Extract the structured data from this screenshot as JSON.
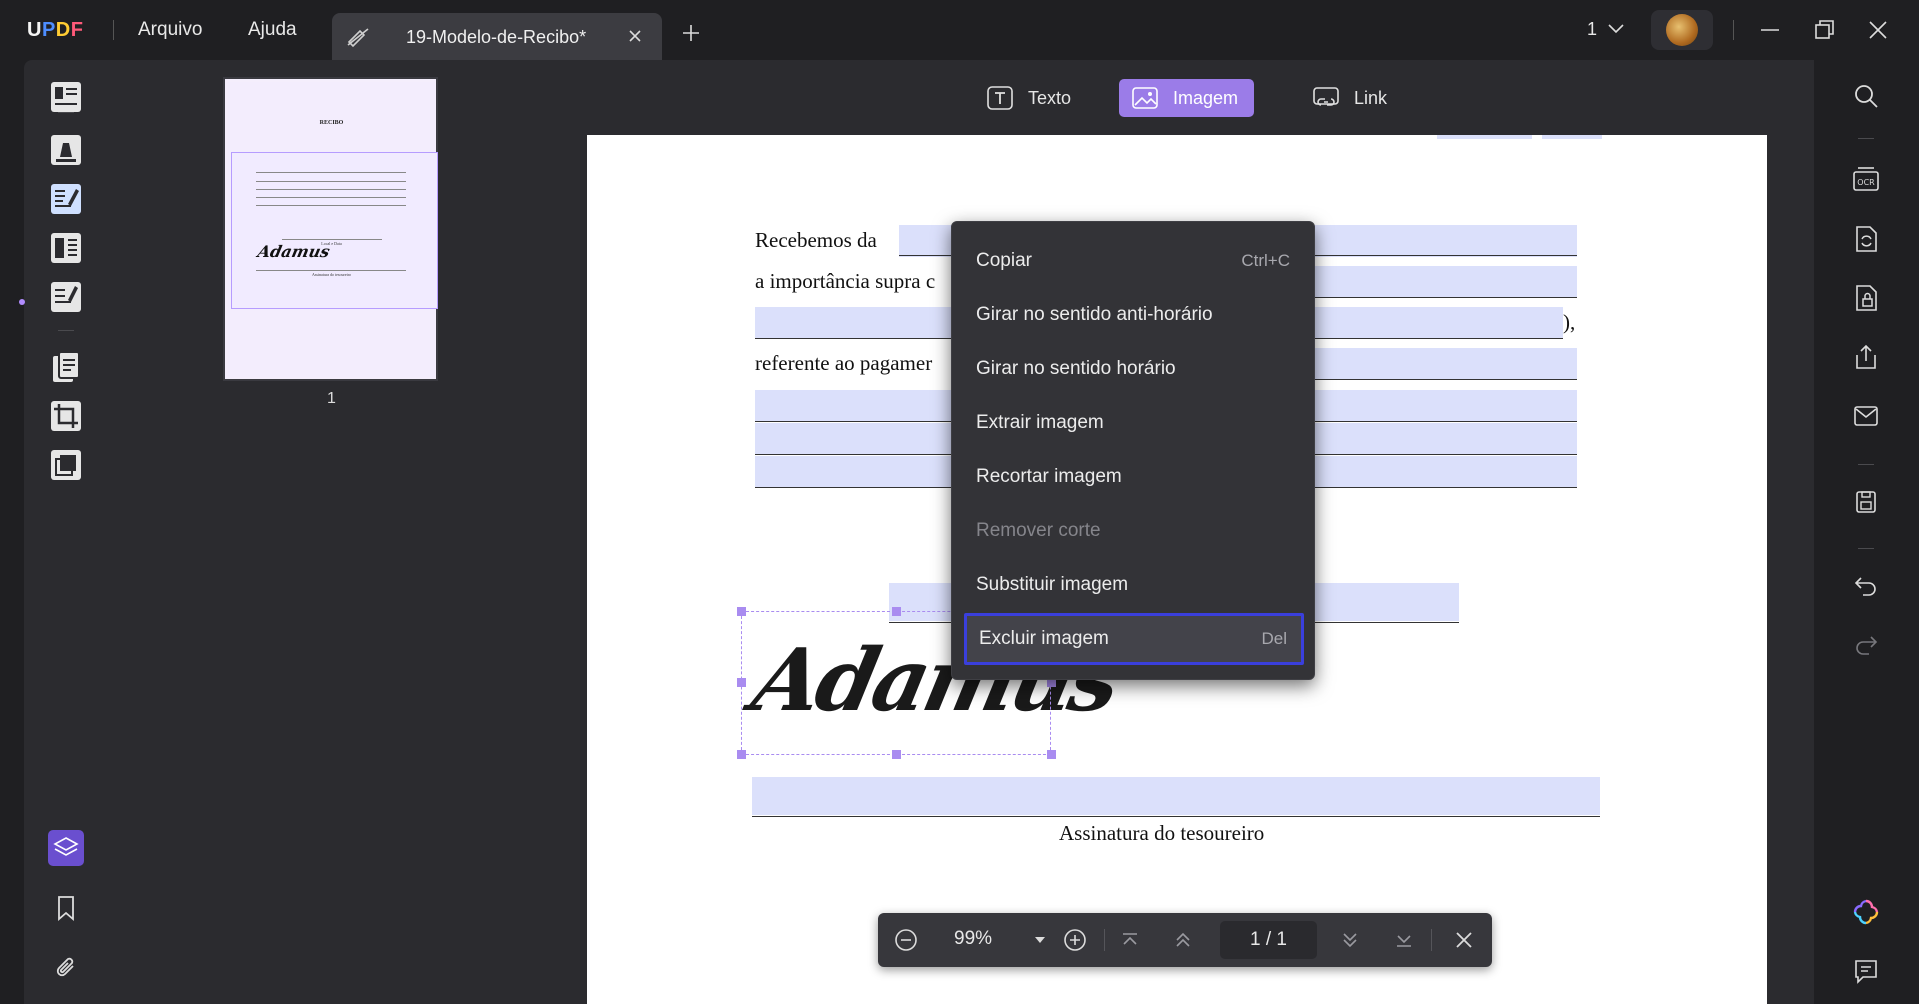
{
  "app": {
    "logo": {
      "u": "U",
      "p": "P",
      "d": "D",
      "f": "F"
    },
    "menu": [
      "Arquivo",
      "Ajuda"
    ],
    "tab_title": "19-Modelo-de-Recibo*",
    "page_indicator": "1"
  },
  "toolbar_modes": [
    {
      "label": "Texto",
      "active": false
    },
    {
      "label": "Imagem",
      "active": true
    },
    {
      "label": "Link",
      "active": false
    }
  ],
  "thumbnails": {
    "page_number": "1",
    "mini_title": "RECIBO",
    "mini_signature": "Adamus",
    "mini_place_date": "Local e Data",
    "mini_treasurer": "Assinatura do tesoureiro"
  },
  "document": {
    "line1_label": "Recebemos da",
    "line2_label": "a importância supra c",
    "line3_end": "),",
    "line4_label": "referente ao pagamer",
    "signature": "Adamus",
    "treasurer_label": "Assinatura do tesoureiro"
  },
  "context_menu": [
    {
      "label": "Copiar",
      "shortcut": "Ctrl+C",
      "disabled": false,
      "highlighted": false
    },
    {
      "label": "Girar no sentido anti-horário",
      "shortcut": "",
      "disabled": false,
      "highlighted": false
    },
    {
      "label": "Girar no sentido horário",
      "shortcut": "",
      "disabled": false,
      "highlighted": false
    },
    {
      "label": "Extrair imagem",
      "shortcut": "",
      "disabled": false,
      "highlighted": false
    },
    {
      "label": "Recortar imagem",
      "shortcut": "",
      "disabled": false,
      "highlighted": false
    },
    {
      "label": "Remover corte",
      "shortcut": "",
      "disabled": true,
      "highlighted": false
    },
    {
      "label": "Substituir imagem",
      "shortcut": "",
      "disabled": false,
      "highlighted": false
    },
    {
      "label": "Excluir imagem",
      "shortcut": "Del",
      "disabled": false,
      "highlighted": true
    }
  ],
  "zoom_bar": {
    "zoom": "99%",
    "current_page": "1",
    "separator": "/",
    "total_pages": "1"
  },
  "colors": {
    "accent": "#9b7ce8",
    "field_highlight": "#dbe0fb",
    "menu_highlight_border": "#3a3fdc"
  }
}
